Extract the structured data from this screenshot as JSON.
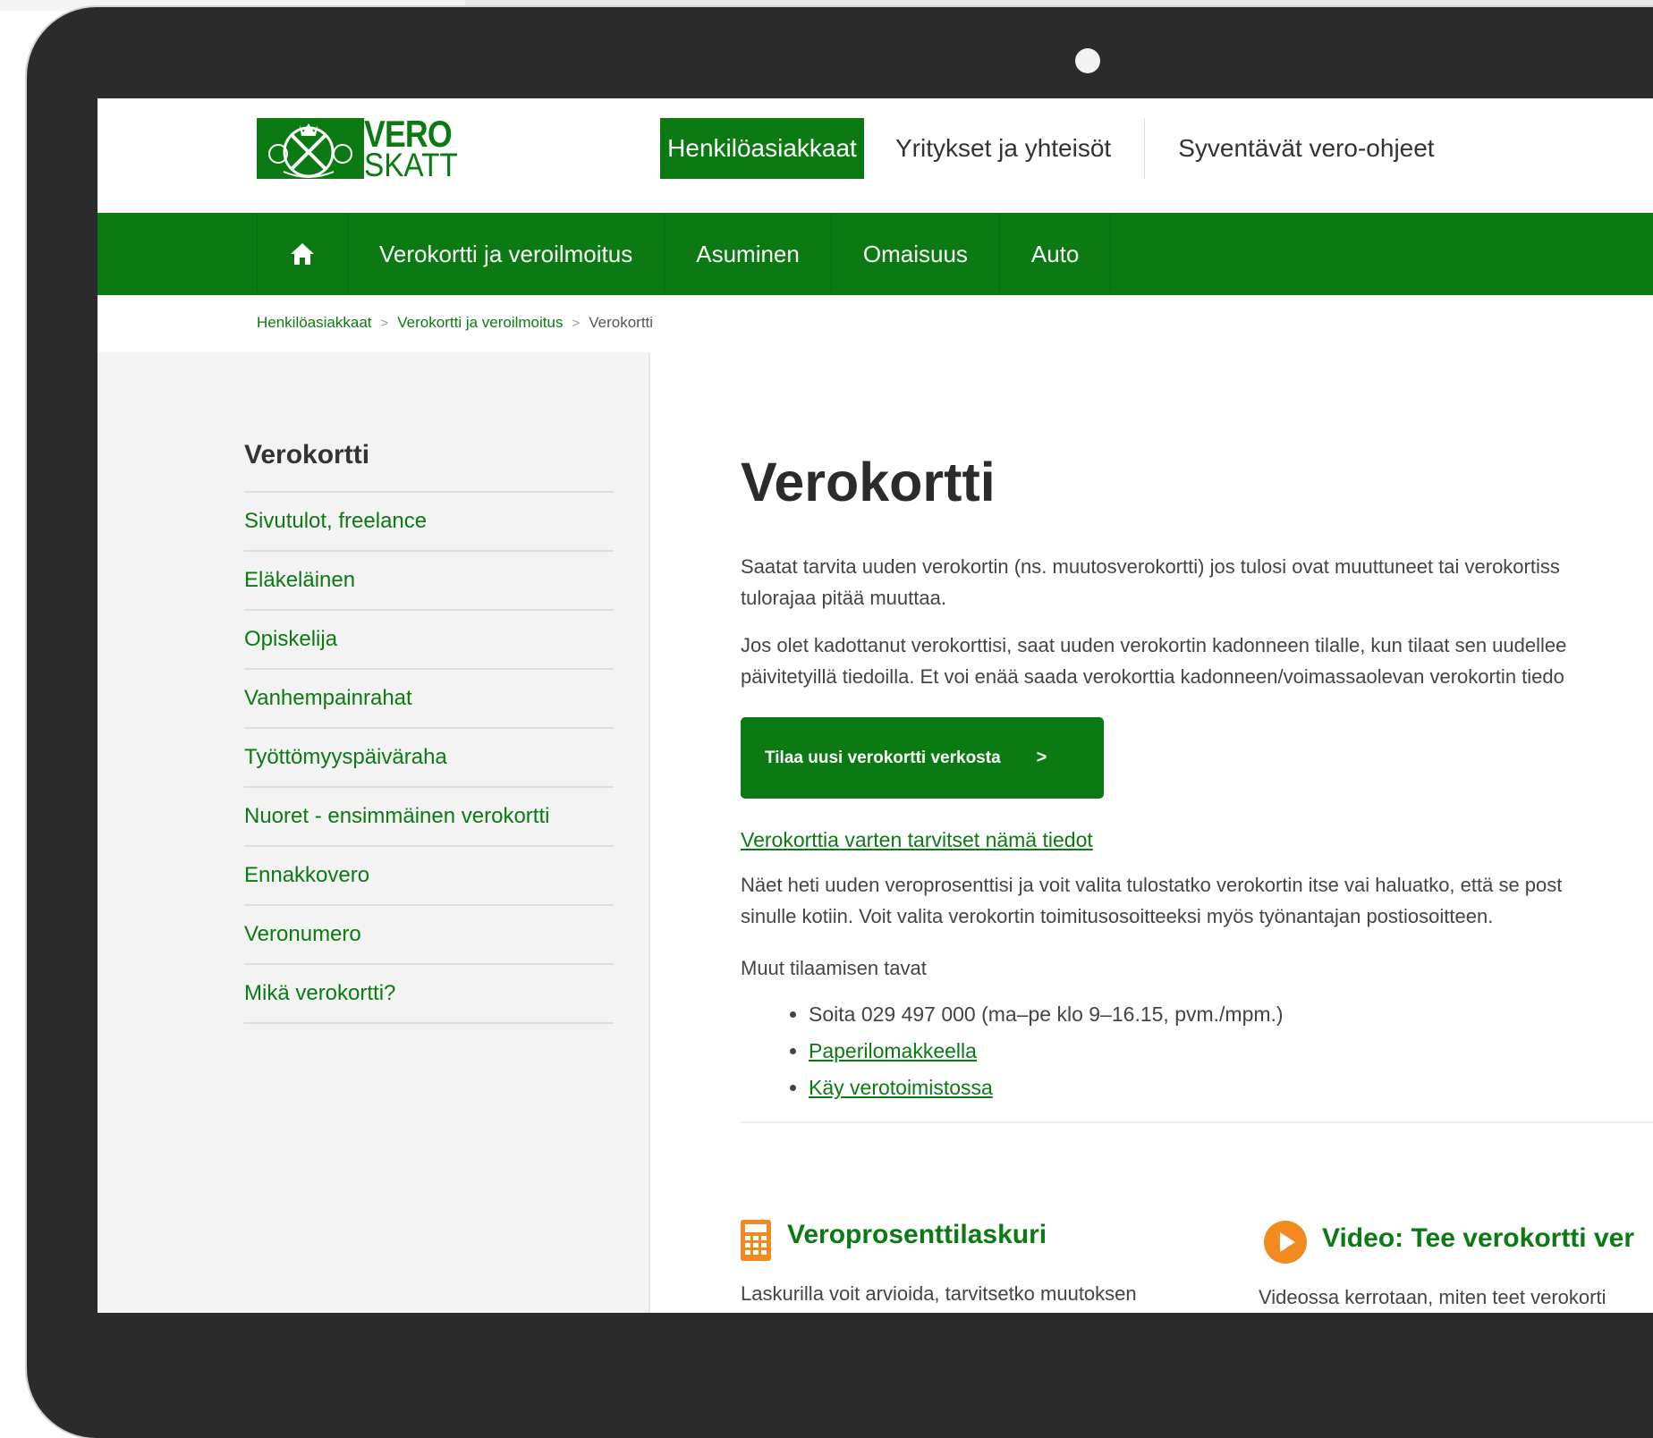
{
  "brand": {
    "logo_line1": "VERO",
    "logo_line2": "SKATT",
    "color_green": "#0b7a12"
  },
  "top_nav": {
    "items": [
      "Henkilöasiakkaat",
      "Yritykset ja yhteisöt",
      "Syventävät vero-ohjeet"
    ],
    "active_index": 0
  },
  "main_nav": {
    "home_icon": "home-icon",
    "items": [
      "Verokortti ja veroilmoitus",
      "Asuminen",
      "Omaisuus",
      "Auto"
    ]
  },
  "breadcrumb": {
    "items": [
      "Henkilöasiakkaat",
      "Verokortti ja veroilmoitus"
    ],
    "separator": ">",
    "current": "Verokortti"
  },
  "sidebar": {
    "title": "Verokortti",
    "items": [
      "Sivutulot, freelance",
      "Eläkeläinen",
      "Opiskelija",
      "Vanhempainrahat",
      "Työttömyyspäiväraha",
      "Nuoret - ensimmäinen verokortti",
      "Ennakkovero",
      "Veronumero",
      "Mikä verokortti?"
    ]
  },
  "main": {
    "title": "Verokortti",
    "intro_line1": "Saatat tarvita uuden verokortin (ns. muutosverokortti) jos tulosi ovat muuttuneet tai verokortiss",
    "intro_line2": "tulorajaa pitää muuttaa.",
    "lost_line1": "Jos olet kadottanut verokorttisi, saat uuden verokortin kadonneen tilalle, kun tilaat sen uudellee",
    "lost_line2": "päivitetyillä tiedoilla. Et voi enää saada verokorttia kadonneen/voimassaolevan verokortin tiedo",
    "cta_label": "Tilaa uusi verokortti verkosta",
    "cta_chevron": ">",
    "requirements_link": "Verokorttia varten tarvitset nämä tiedot",
    "info_line1": "Näet heti uuden veroprosenttisi ja voit valita tulostatko verokortin itse vai haluatko, että se post",
    "info_line2": "sinulle kotiin. Voit valita verokortin toimitusosoitteeksi myös työnantajan postiosoitteen.",
    "other_ways_label": "Muut tilaamisen tavat",
    "other_ways": {
      "phone": "Soita 029 497 000 (ma–pe klo 9–16.15, pvm./mpm.)",
      "paper_link": "Paperilomakkeella",
      "office_link": "Käy verotoimistossa"
    }
  },
  "features": {
    "calculator": {
      "icon": "calculator-icon",
      "title": "Veroprosenttilaskuri",
      "text": "Laskurilla voit arvioida, tarvitsetko muutoksen"
    },
    "video": {
      "icon": "play-icon",
      "title": "Video: Tee verokortti ver",
      "text": "Videossa kerrotaan, miten teet verokorti"
    }
  }
}
